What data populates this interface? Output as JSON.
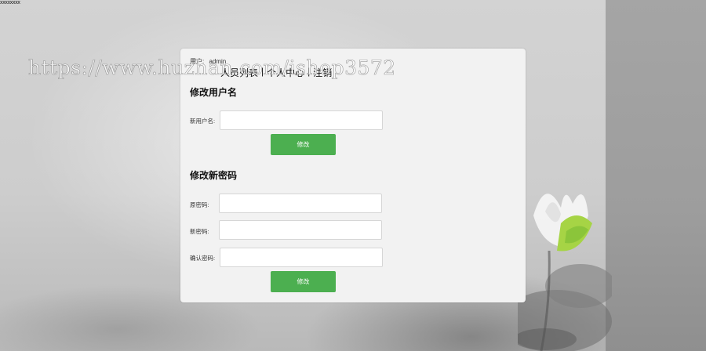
{
  "page": {
    "corner_text": "xxxxxxxx",
    "watermark": "https://www.huzhan.com/ishop3572"
  },
  "user": {
    "label": "用户:",
    "name": "admin"
  },
  "nav": {
    "items": [
      {
        "label": "人员列表"
      },
      {
        "label": "个人中心"
      },
      {
        "label": "注销"
      }
    ],
    "separator": "|"
  },
  "username_section": {
    "title": "修改用户名",
    "new_username_label": "新用户名:",
    "new_username_value": "",
    "submit_label": "修改"
  },
  "password_section": {
    "title": "修改新密码",
    "old_password_label": "原密码:",
    "new_password_label": "新密码:",
    "confirm_password_label": "确认密码:",
    "submit_label": "修改"
  },
  "colors": {
    "button_green": "#4caf50",
    "panel_bg": "#f2f2f2"
  }
}
